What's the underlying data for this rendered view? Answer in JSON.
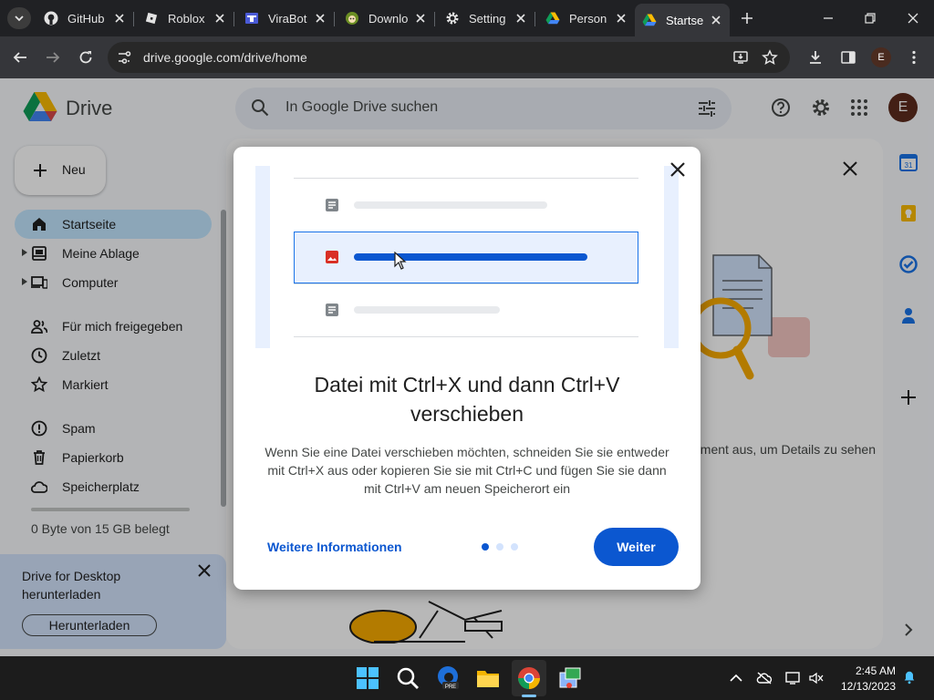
{
  "browser": {
    "tabs": [
      {
        "title": "GitHub",
        "icon": "github-icon"
      },
      {
        "title": "Roblox",
        "icon": "roblox-icon"
      },
      {
        "title": "ViraBot",
        "icon": "virabot-icon"
      },
      {
        "title": "Downlo",
        "icon": "download-site-icon"
      },
      {
        "title": "Setting",
        "icon": "gear-icon"
      },
      {
        "title": "Person",
        "icon": "drive-icon"
      },
      {
        "title": "Startse",
        "icon": "drive-icon",
        "active": true
      }
    ],
    "url": "drive.google.com/drive/home",
    "profile_initial": "E"
  },
  "drive": {
    "app_name": "Drive",
    "search_placeholder": "In Google Drive suchen",
    "user_initial": "E",
    "new_label": "Neu",
    "nav": [
      {
        "label": "Startseite",
        "icon": "home-icon",
        "active": true
      },
      {
        "label": "Meine Ablage",
        "icon": "drive-folder-icon"
      },
      {
        "label": "Computer",
        "icon": "computer-icon"
      },
      {
        "label": "Für mich freigegeben",
        "icon": "people-icon"
      },
      {
        "label": "Zuletzt",
        "icon": "clock-icon"
      },
      {
        "label": "Markiert",
        "icon": "star-icon"
      },
      {
        "label": "Spam",
        "icon": "spam-icon"
      },
      {
        "label": "Papierkorb",
        "icon": "trash-icon"
      },
      {
        "label": "Speicherplatz",
        "icon": "cloud-icon"
      }
    ],
    "storage_text": "0 Byte von 15 GB belegt",
    "promo": {
      "title": "Drive for Desktop herunterladen",
      "button": "Herunterladen"
    },
    "details_hint": "ement aus, um Details zu sehen"
  },
  "dialog": {
    "title": "Datei mit Ctrl+X und dann Ctrl+V verschieben",
    "body": "Wenn Sie eine Datei verschieben möchten, schneiden Sie sie entweder mit Ctrl+X aus oder kopieren Sie sie mit Ctrl+C und fügen Sie sie dann mit Ctrl+V am neuen Speicherort ein",
    "link": "Weitere Informationen",
    "next": "Weiter",
    "step_current": 1,
    "step_total": 3
  },
  "taskbar": {
    "time": "2:45 AM",
    "date": "12/13/2023"
  },
  "colors": {
    "accent": "#0b57d0",
    "nav_active": "#c2e7ff",
    "promo_bg": "#d3e3fd"
  }
}
